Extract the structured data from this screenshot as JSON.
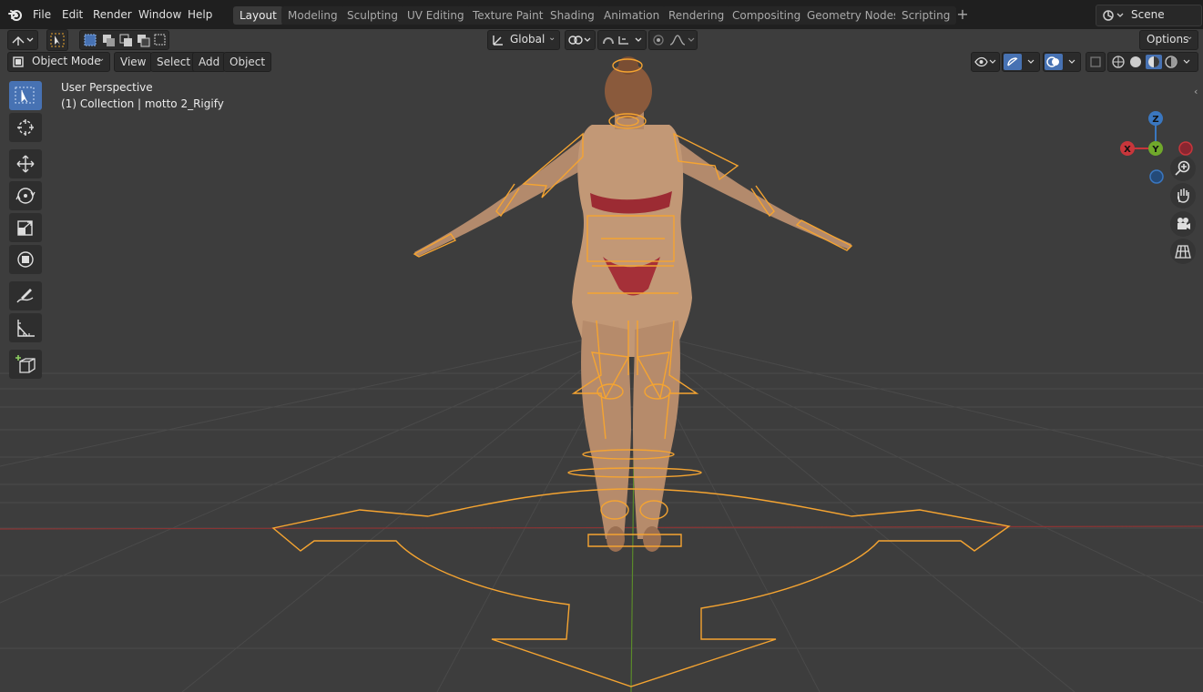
{
  "menus": [
    "File",
    "Edit",
    "Render",
    "Window",
    "Help"
  ],
  "workspaces": [
    "Layout",
    "Modeling",
    "Sculpting",
    "UV Editing",
    "Texture Paint",
    "Shading",
    "Animation",
    "Rendering",
    "Compositing",
    "Geometry Nodes",
    "Scripting"
  ],
  "active_workspace": "Layout",
  "scene": "Scene",
  "header": {
    "transform_orientation": "Global",
    "options": "Options"
  },
  "mode_bar": {
    "mode": "Object Mode",
    "view": "View",
    "select": "Select",
    "add": "Add",
    "object": "Object"
  },
  "viewport_info": {
    "line1": "User Perspective",
    "line2": "(1) Collection | motto 2_Rigify"
  },
  "gizmo": {
    "x": "X",
    "y": "Y",
    "z": "Z"
  },
  "colors": {
    "accent": "#4772b3",
    "bone": "#f5a431",
    "x_axis": "#c8363b",
    "y_axis": "#70a82b",
    "z_axis": "#3a77c0"
  },
  "icons": [
    "blender-logo-icon",
    "select-box-icon",
    "cursor-icon",
    "move-icon",
    "rotate-icon",
    "scale-icon",
    "transform-icon",
    "annotate-icon",
    "measure-icon",
    "add-cube-icon",
    "zoom-icon",
    "hand-pan-icon",
    "camera-icon",
    "grid-ortho-icon"
  ]
}
